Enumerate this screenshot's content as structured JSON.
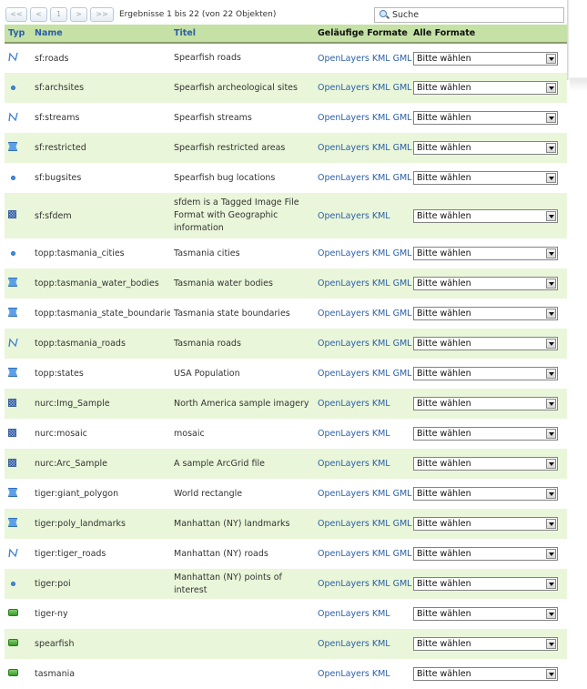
{
  "pager": {
    "first_label": "<<",
    "prev_label": "<",
    "page_label": "1",
    "next_label": ">",
    "last_label": ">>",
    "summary": "Ergebnisse 1 bis 22 (von 22 Objekten)"
  },
  "search": {
    "placeholder": "Suche"
  },
  "columns": {
    "typ": "Typ",
    "name": "Name",
    "titel": "Titel",
    "common_formats": "Geläufige Formate",
    "all_formats": "Alle Formate"
  },
  "select_default": "Bitte wählen",
  "rows": [
    {
      "type_icon": "line-icon",
      "name": "sf:roads",
      "title": "Spearfish roads",
      "formats": [
        "OpenLayers",
        "KML",
        "GML"
      ]
    },
    {
      "type_icon": "point-icon",
      "name": "sf:archsites",
      "title": "Spearfish archeological sites",
      "formats": [
        "OpenLayers",
        "KML",
        "GML"
      ]
    },
    {
      "type_icon": "line-icon",
      "name": "sf:streams",
      "title": "Spearfish streams",
      "formats": [
        "OpenLayers",
        "KML",
        "GML"
      ]
    },
    {
      "type_icon": "polygon-icon",
      "name": "sf:restricted",
      "title": "Spearfish restricted areas",
      "formats": [
        "OpenLayers",
        "KML",
        "GML"
      ]
    },
    {
      "type_icon": "point-icon",
      "name": "sf:bugsites",
      "title": "Spearfish bug locations",
      "formats": [
        "OpenLayers",
        "KML",
        "GML"
      ]
    },
    {
      "type_icon": "raster-icon",
      "name": "sf:sfdem",
      "title": "sfdem is a Tagged Image File Format with Geographic information",
      "formats": [
        "OpenLayers",
        "KML"
      ]
    },
    {
      "type_icon": "point-icon",
      "name": "topp:tasmania_cities",
      "title": "Tasmania cities",
      "formats": [
        "OpenLayers",
        "KML",
        "GML"
      ]
    },
    {
      "type_icon": "polygon-icon",
      "name": "topp:tasmania_water_bodies",
      "title": "Tasmania water bodies",
      "formats": [
        "OpenLayers",
        "KML",
        "GML"
      ]
    },
    {
      "type_icon": "polygon-icon",
      "name": "topp:tasmania_state_boundaries",
      "title": "Tasmania state boundaries",
      "formats": [
        "OpenLayers",
        "KML",
        "GML"
      ]
    },
    {
      "type_icon": "line-icon",
      "name": "topp:tasmania_roads",
      "title": "Tasmania roads",
      "formats": [
        "OpenLayers",
        "KML",
        "GML"
      ]
    },
    {
      "type_icon": "polygon-icon",
      "name": "topp:states",
      "title": "USA Population",
      "formats": [
        "OpenLayers",
        "KML",
        "GML"
      ]
    },
    {
      "type_icon": "raster-icon",
      "name": "nurc:Img_Sample",
      "title": "North America sample imagery",
      "formats": [
        "OpenLayers",
        "KML"
      ]
    },
    {
      "type_icon": "raster-icon",
      "name": "nurc:mosaic",
      "title": "mosaic",
      "formats": [
        "OpenLayers",
        "KML"
      ]
    },
    {
      "type_icon": "raster-icon",
      "name": "nurc:Arc_Sample",
      "title": "A sample ArcGrid file",
      "formats": [
        "OpenLayers",
        "KML"
      ]
    },
    {
      "type_icon": "polygon-icon",
      "name": "tiger:giant_polygon",
      "title": "World rectangle",
      "formats": [
        "OpenLayers",
        "KML",
        "GML"
      ]
    },
    {
      "type_icon": "polygon-icon",
      "name": "tiger:poly_landmarks",
      "title": "Manhattan (NY) landmarks",
      "formats": [
        "OpenLayers",
        "KML",
        "GML"
      ]
    },
    {
      "type_icon": "line-icon",
      "name": "tiger:tiger_roads",
      "title": "Manhattan (NY) roads",
      "formats": [
        "OpenLayers",
        "KML",
        "GML"
      ]
    },
    {
      "type_icon": "point-icon",
      "name": "tiger:poi",
      "title": "Manhattan (NY) points of interest",
      "formats": [
        "OpenLayers",
        "KML",
        "GML"
      ]
    },
    {
      "type_icon": "layer-group-icon",
      "name": "tiger-ny",
      "title": "",
      "formats": [
        "OpenLayers",
        "KML"
      ]
    },
    {
      "type_icon": "layer-group-icon",
      "name": "spearfish",
      "title": "",
      "formats": [
        "OpenLayers",
        "KML"
      ]
    },
    {
      "type_icon": "layer-group-icon",
      "name": "tasmania",
      "title": "",
      "formats": [
        "OpenLayers",
        "KML"
      ]
    }
  ]
}
